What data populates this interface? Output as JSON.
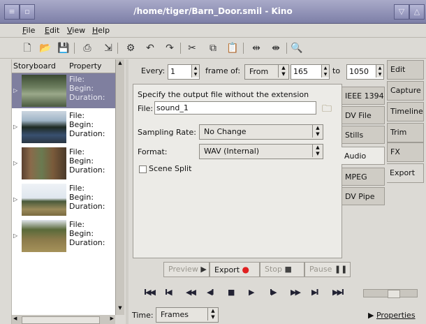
{
  "window": {
    "title": "/home/tiger/Barn_Door.smil - Kino"
  },
  "menu": [
    {
      "label": "File",
      "ul": "F",
      "rest": "ile"
    },
    {
      "label": "Edit",
      "ul": "E",
      "rest": "dit"
    },
    {
      "label": "View",
      "ul": "V",
      "rest": "iew"
    },
    {
      "label": "Help",
      "ul": "H",
      "rest": "elp"
    }
  ],
  "toolbar_icons": [
    "new-icon",
    "open-icon",
    "save-icon",
    "capture-icon",
    "import-icon",
    "preferences-icon",
    "undo-icon",
    "redo-icon",
    "cut-icon",
    "copy-icon",
    "paste-icon",
    "split-icon",
    "join-icon",
    "zoom-icon"
  ],
  "storyboard": {
    "headers": [
      "Storyboard",
      "Property"
    ],
    "clips": [
      {
        "file": "File:",
        "begin": "Begin:",
        "duration": "Duration:"
      },
      {
        "file": "File:",
        "begin": "Begin:",
        "duration": "Duration:"
      },
      {
        "file": "File:",
        "begin": "Begin:",
        "duration": "Duration:"
      },
      {
        "file": "File:",
        "begin": "Begin:",
        "duration": "Duration:"
      },
      {
        "file": "File:",
        "begin": "Begin:",
        "duration": "Duration:"
      }
    ]
  },
  "range": {
    "every_label": "Every:",
    "every_value": "1",
    "frame_of_label": "frame of:",
    "scope": "From",
    "from_value": "165",
    "to_label": "to",
    "to_value": "1050"
  },
  "export": {
    "instruction": "Specify the output file without the extension",
    "file_label": "File:",
    "file_value": "sound_1",
    "sampling_label": "Sampling Rate:",
    "sampling_value": "No Change",
    "format_label": "Format:",
    "format_value": "WAV (Internal)",
    "scene_split_label": "Scene Split"
  },
  "subtabs": [
    "IEEE 1394",
    "DV File",
    "Stills",
    "Audio",
    "MPEG",
    "DV Pipe"
  ],
  "maintabs": [
    "Edit",
    "Capture",
    "Timeline",
    "Trim",
    "FX",
    "Export"
  ],
  "actions": {
    "preview": "Preview",
    "export": "Export",
    "stop": "Stop",
    "pause": "Pause"
  },
  "transport": [
    "I◀◀",
    "I◀",
    "◀◀",
    "◀I",
    "■",
    "▶",
    "I▶",
    "▶▶",
    "▶I",
    "▶▶I"
  ],
  "bottom": {
    "time_label": "Time:",
    "time_unit": "Frames",
    "properties": "Properties"
  },
  "colors": {
    "title_bar": "#8486ae",
    "selected_clip": "#7f7f9f",
    "record": "#e02020"
  }
}
